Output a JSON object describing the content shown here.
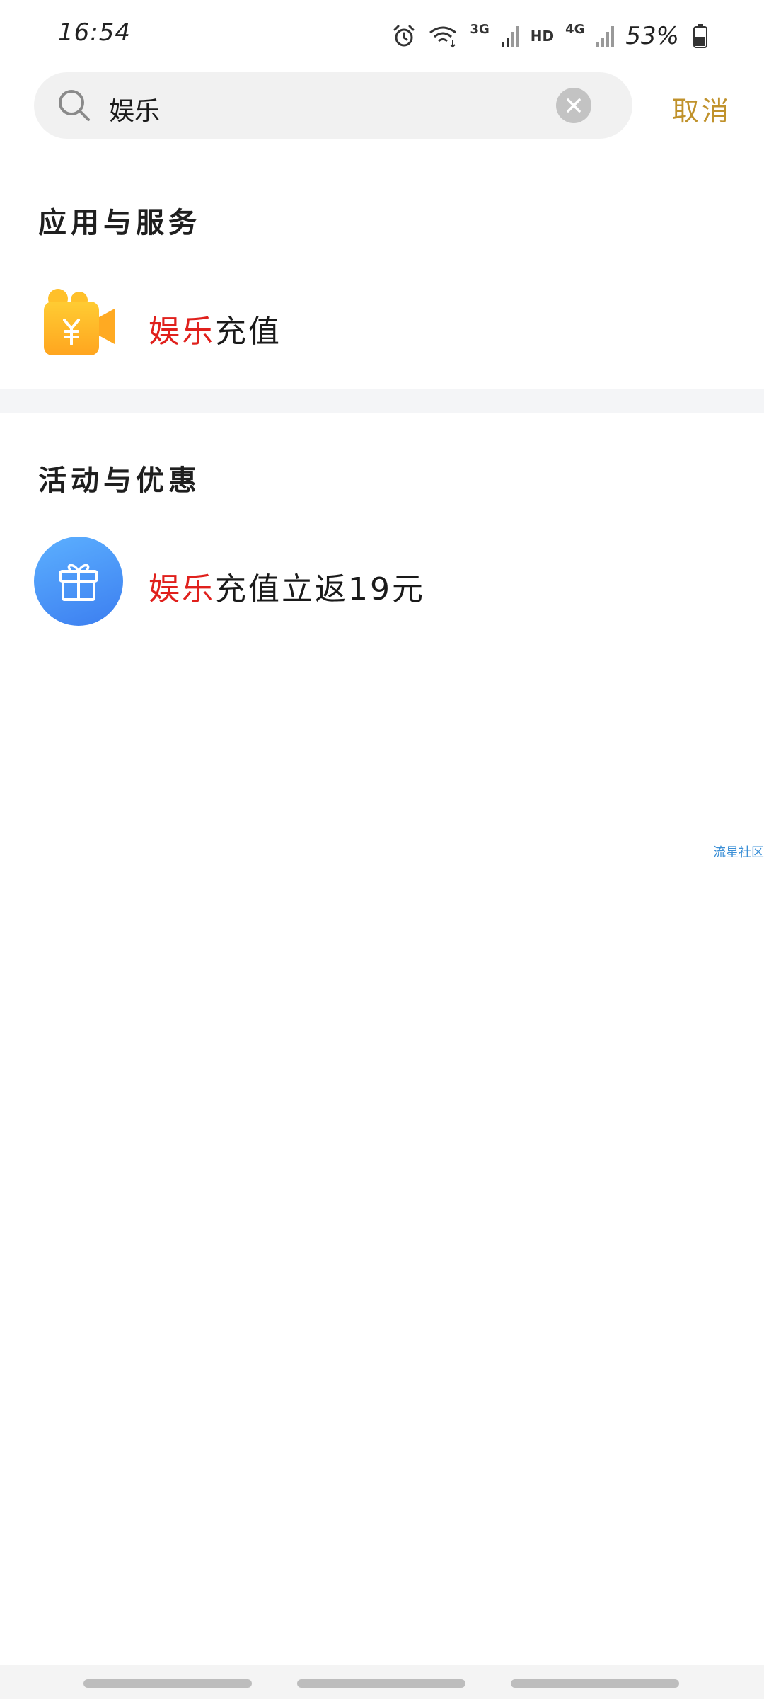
{
  "status_bar": {
    "time": "16:54",
    "network_1": "3G",
    "hd": "HD",
    "network_2": "4G",
    "battery": "53%",
    "icons": [
      "alarm-icon",
      "wifi-icon",
      "signal-icon",
      "signal-icon",
      "battery-icon"
    ]
  },
  "search": {
    "value": "娱乐",
    "cancel_label": "取消"
  },
  "sections": {
    "apps": {
      "title": "应用与服务",
      "item": {
        "highlight": "娱乐",
        "rest": "充值",
        "icon": "recharge-icon"
      }
    },
    "promotions": {
      "title": "活动与优惠",
      "item": {
        "highlight": "娱乐",
        "rest": "充值立返19元",
        "icon": "gift-icon"
      }
    }
  },
  "watermark": "流星社区",
  "colors": {
    "highlight": "#e0201c",
    "cancel": "#c0922c",
    "gift_gradient_start": "#5cb0ff",
    "gift_gradient_end": "#3c7ef0",
    "recharge_icon": "#ffb020"
  }
}
